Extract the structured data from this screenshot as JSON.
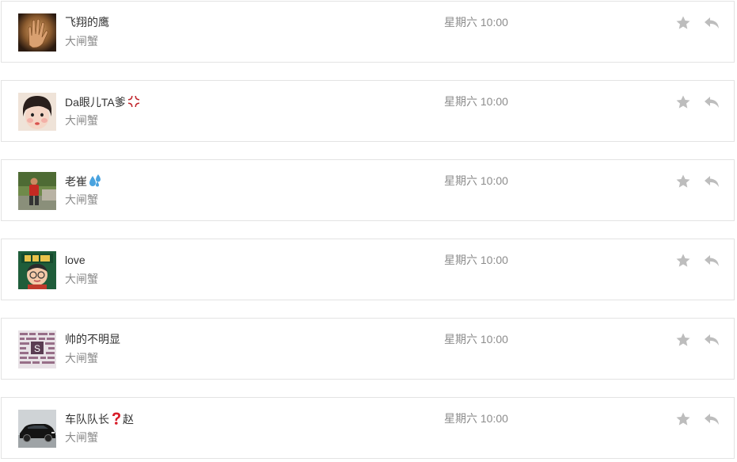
{
  "messages": [
    {
      "name": "飞翔的鹰",
      "emoji": "",
      "subtitle": "大闸蟹",
      "time": "星期六 10:00",
      "avatar": "hand-photo"
    },
    {
      "name": "Da眼儿TA爹",
      "emoji": "anger-symbol",
      "subtitle": "大闸蟹",
      "time": "星期六 10:00",
      "avatar": "child-photo"
    },
    {
      "name": "老崔",
      "emoji": "sweat-droplets",
      "subtitle": "大闸蟹",
      "time": "星期六 10:00",
      "avatar": "person-outdoor-photo"
    },
    {
      "name": "love",
      "emoji": "",
      "subtitle": "大闸蟹",
      "time": "星期六 10:00",
      "avatar": "cartoon-teacher-day"
    },
    {
      "name": "帅的不明显",
      "emoji": "",
      "subtitle": "大闸蟹",
      "time": "星期六 10:00",
      "avatar": "collage-photo"
    },
    {
      "name": "车队队长",
      "emoji": "question-mark",
      "name_suffix": "赵",
      "subtitle": "大闸蟹",
      "time": "星期六 10:00",
      "avatar": "car-photo"
    }
  ],
  "icons": {
    "favorite": "star-icon",
    "reply": "reply-icon"
  },
  "colors": {
    "icon_gray": "#bdbdbd",
    "border": "#e3e3e3",
    "name": "#333333",
    "muted": "#8c8c8c"
  }
}
